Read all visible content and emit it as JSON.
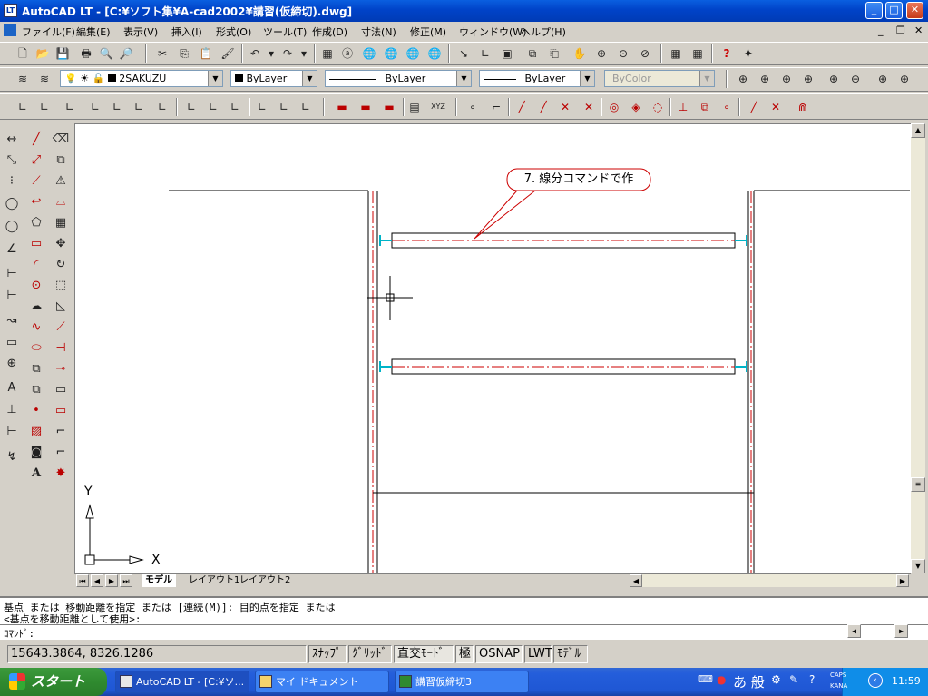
{
  "window": {
    "app_name": "AutoCAD LT - [C:¥ソフト集¥A-cad2002¥講習(仮締切).dwg]",
    "app_icon": "LT",
    "min_label": "_",
    "max_label": "□",
    "close_label": "✕"
  },
  "menu": {
    "items": [
      "ファイル(F)",
      "編集(E)",
      "表示(V)",
      "挿入(I)",
      "形式(O)",
      "ツール(T)",
      "作成(D)",
      "寸法(N)",
      "修正(M)",
      "ウィンドウ(W)",
      "ヘルプ(H)"
    ],
    "doc_min": "_",
    "doc_restore": "❐",
    "doc_close": "✕"
  },
  "layers_toolbar": {
    "layer_name": "2SAKUZU",
    "color": "ByLayer",
    "linetype": "ByLayer",
    "lineweight": "ByLayer",
    "plotstyle": "ByColor"
  },
  "drawing": {
    "callout_text": "7. 線分コマンドで作",
    "ucs_x": "X",
    "ucs_y": "Y",
    "callout_border": "#cc0000",
    "centerline_color": "#cc0000",
    "dimension_color": "#00b4c8"
  },
  "layout_tabs": {
    "model": "モデル",
    "layout1": "レイアウト1",
    "layout2": "レイアウト2"
  },
  "command": {
    "line1": "基点 または 移動距離を指定 または [連続(M)]: 目的点を指定 または",
    "line2": "<基点を移動距離として使用>:",
    "prompt": "ｺﾏﾝﾄﾞ:"
  },
  "status": {
    "coords": "15643.3864, 8326.1286",
    "snap": "ｽﾅｯﾌﾟ",
    "grid": "ｸﾞﾘｯﾄﾞ",
    "ortho": "直交ﾓｰﾄﾞ",
    "polar": "極",
    "osnap": "OSNAP",
    "lwt": "LWT",
    "model": "ﾓﾃﾞﾙ"
  },
  "taskbar": {
    "start": "スタート",
    "tasks": [
      "AutoCAD LT - [C:¥ソ...",
      "マイ ドキュメント",
      "講習仮締切3"
    ],
    "ime": "あ 般",
    "caps": "CAPS",
    "kana": "KANA",
    "clock": "11:59"
  }
}
